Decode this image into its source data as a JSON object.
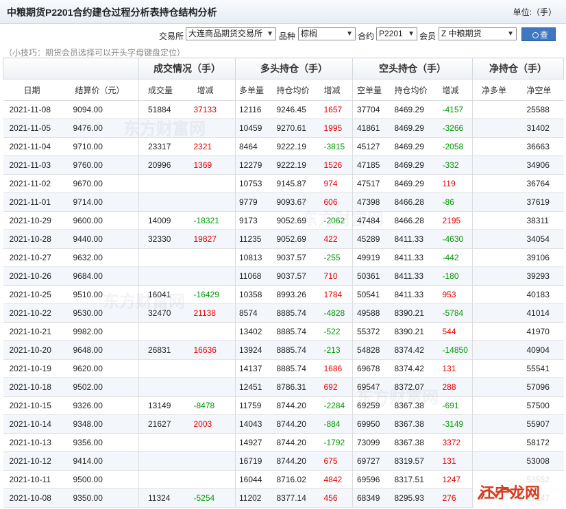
{
  "header": {
    "title": "中粮期货P2201合约建仓过程分析表持仓结构分析",
    "unit": "单位:（手）"
  },
  "filters": {
    "exchange_label": "交易所",
    "exchange_value": "大连商品期货交易所",
    "variety_label": "品种",
    "variety_value": "棕榈",
    "contract_label": "合约",
    "contract_value": "P2201",
    "member_label": "会员",
    "member_value": "Z 中粮期货",
    "query_label": "查询"
  },
  "tip": "（小技巧：期货会员选择可以开头字母键盘定位）",
  "table": {
    "group_headers": {
      "volume": "成交情况（手）",
      "long": "多头持仓（手）",
      "short": "空头持仓（手）",
      "net": "净持仓（手）"
    },
    "columns": [
      "日期",
      "结算价（元）",
      "成交量",
      "增减",
      "多单量",
      "持仓均价",
      "增减",
      "空单量",
      "持仓均价",
      "增减",
      "净多单",
      "净空单"
    ],
    "rows": [
      [
        "2021-11-08",
        "9094.00",
        "51884",
        "37133",
        "12116",
        "9246.45",
        "1657",
        "37704",
        "8469.29",
        "-4157",
        "",
        "25588"
      ],
      [
        "2021-11-05",
        "9476.00",
        "",
        "",
        "10459",
        "9270.61",
        "1995",
        "41861",
        "8469.29",
        "-3266",
        "",
        "31402"
      ],
      [
        "2021-11-04",
        "9710.00",
        "23317",
        "2321",
        "8464",
        "9222.19",
        "-3815",
        "45127",
        "8469.29",
        "-2058",
        "",
        "36663"
      ],
      [
        "2021-11-03",
        "9760.00",
        "20996",
        "1369",
        "12279",
        "9222.19",
        "1526",
        "47185",
        "8469.29",
        "-332",
        "",
        "34906"
      ],
      [
        "2021-11-02",
        "9670.00",
        "",
        "",
        "10753",
        "9145.87",
        "974",
        "47517",
        "8469.29",
        "119",
        "",
        "36764"
      ],
      [
        "2021-11-01",
        "9714.00",
        "",
        "",
        "9779",
        "9093.67",
        "606",
        "47398",
        "8466.28",
        "-86",
        "",
        "37619"
      ],
      [
        "2021-10-29",
        "9600.00",
        "14009",
        "-18321",
        "9173",
        "9052.69",
        "-2062",
        "47484",
        "8466.28",
        "2195",
        "",
        "38311"
      ],
      [
        "2021-10-28",
        "9440.00",
        "32330",
        "19827",
        "11235",
        "9052.69",
        "422",
        "45289",
        "8411.33",
        "-4630",
        "",
        "34054"
      ],
      [
        "2021-10-27",
        "9632.00",
        "",
        "",
        "10813",
        "9037.57",
        "-255",
        "49919",
        "8411.33",
        "-442",
        "",
        "39106"
      ],
      [
        "2021-10-26",
        "9684.00",
        "",
        "",
        "11068",
        "9037.57",
        "710",
        "50361",
        "8411.33",
        "-180",
        "",
        "39293"
      ],
      [
        "2021-10-25",
        "9510.00",
        "16041",
        "-16429",
        "10358",
        "8993.26",
        "1784",
        "50541",
        "8411.33",
        "953",
        "",
        "40183"
      ],
      [
        "2021-10-22",
        "9530.00",
        "32470",
        "21138",
        "8574",
        "8885.74",
        "-4828",
        "49588",
        "8390.21",
        "-5784",
        "",
        "41014"
      ],
      [
        "2021-10-21",
        "9982.00",
        "",
        "",
        "13402",
        "8885.74",
        "-522",
        "55372",
        "8390.21",
        "544",
        "",
        "41970"
      ],
      [
        "2021-10-20",
        "9648.00",
        "26831",
        "16636",
        "13924",
        "8885.74",
        "-213",
        "54828",
        "8374.42",
        "-14850",
        "",
        "40904"
      ],
      [
        "2021-10-19",
        "9620.00",
        "",
        "",
        "14137",
        "8885.74",
        "1686",
        "69678",
        "8374.42",
        "131",
        "",
        "55541"
      ],
      [
        "2021-10-18",
        "9502.00",
        "",
        "",
        "12451",
        "8786.31",
        "692",
        "69547",
        "8372.07",
        "288",
        "",
        "57096"
      ],
      [
        "2021-10-15",
        "9326.00",
        "13149",
        "-8478",
        "11759",
        "8744.20",
        "-2284",
        "69259",
        "8367.38",
        "-691",
        "",
        "57500"
      ],
      [
        "2021-10-14",
        "9348.00",
        "21627",
        "2003",
        "14043",
        "8744.20",
        "-884",
        "69950",
        "8367.38",
        "-3149",
        "",
        "55907"
      ],
      [
        "2021-10-13",
        "9356.00",
        "",
        "",
        "14927",
        "8744.20",
        "-1792",
        "73099",
        "8367.38",
        "3372",
        "",
        "58172"
      ],
      [
        "2021-10-12",
        "9414.00",
        "",
        "",
        "16719",
        "8744.20",
        "675",
        "69727",
        "8319.57",
        "131",
        "",
        "53008"
      ],
      [
        "2021-10-11",
        "9500.00",
        "",
        "",
        "16044",
        "8716.02",
        "4842",
        "69596",
        "8317.51",
        "1247",
        "",
        "53552"
      ],
      [
        "2021-10-08",
        "9350.00",
        "11324",
        "-5254",
        "11202",
        "8377.14",
        "456",
        "68349",
        "8295.93",
        "276",
        "",
        "57147"
      ]
    ]
  },
  "watermark": "东方财富网",
  "corner_logo": "江宁龙网",
  "colors": {
    "up": "#e60000",
    "down": "#009900",
    "header_bg": "#eef1f5",
    "stripe": "#f3f6fa",
    "button": "#3f77c1"
  }
}
